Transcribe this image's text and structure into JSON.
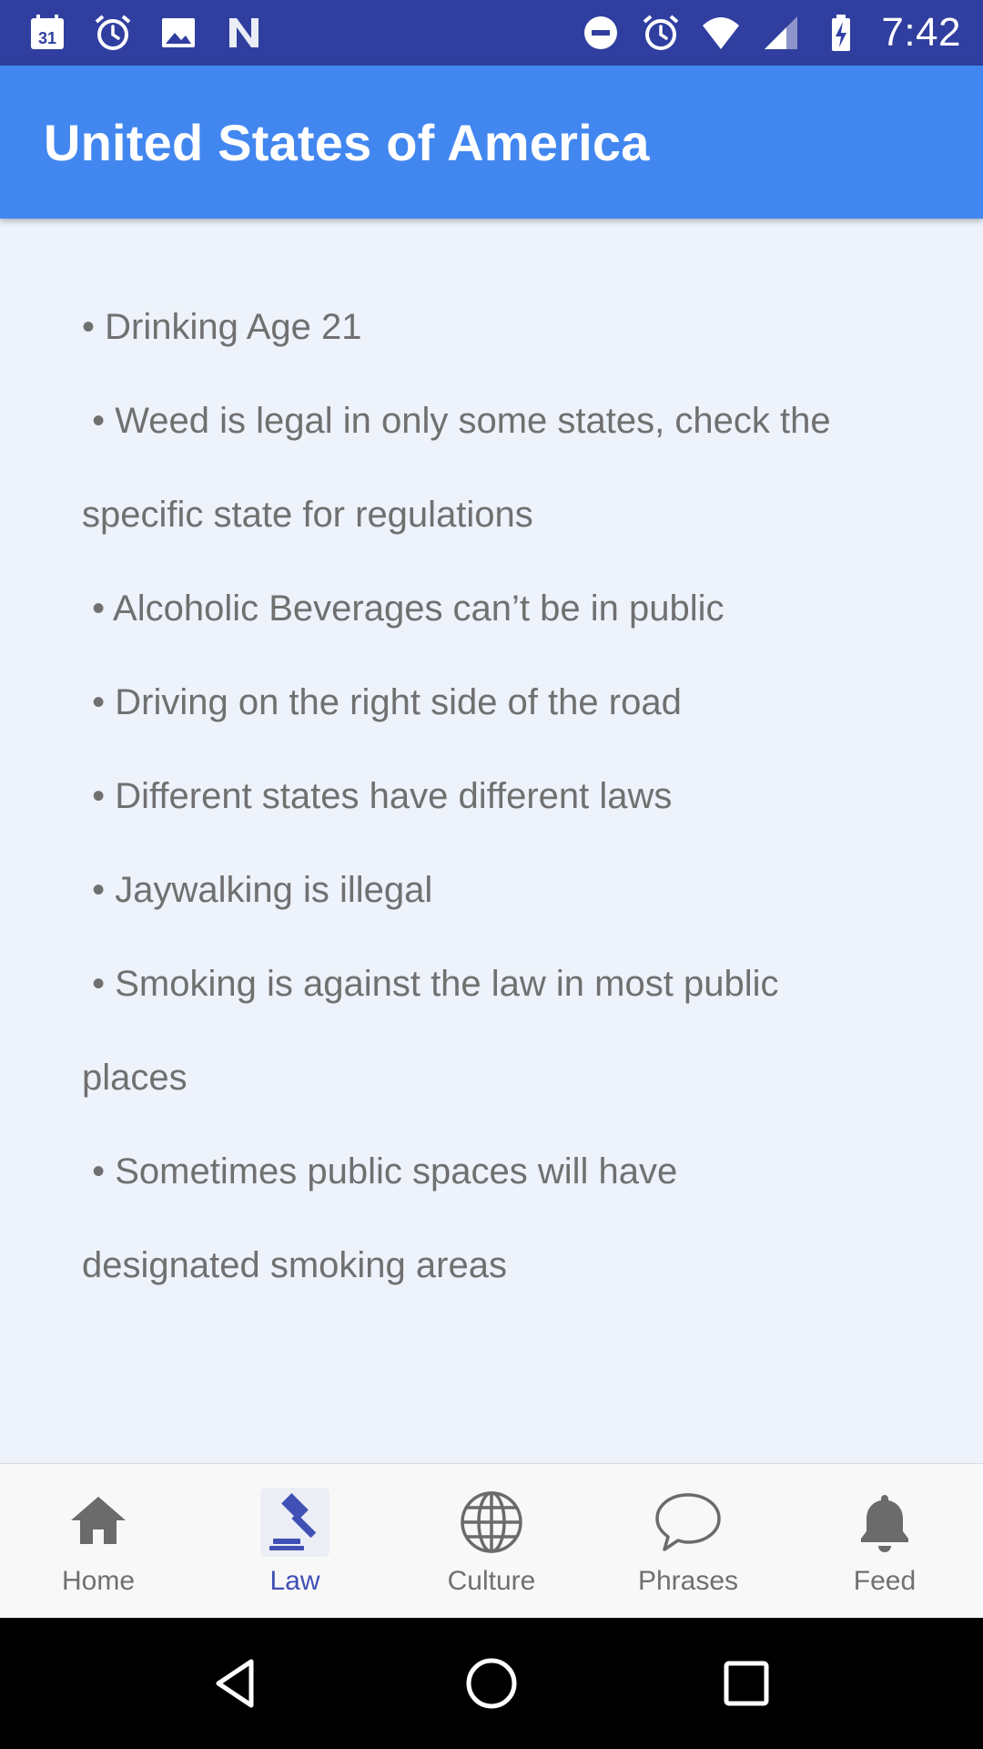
{
  "status_bar": {
    "left_icons": [
      "calendar-icon",
      "alarm-icon",
      "image-icon",
      "n-icon"
    ],
    "calendar_day": "31",
    "right_icons": [
      "dnd-icon",
      "alarm-icon",
      "wifi-icon",
      "signal-icon",
      "battery-charging-icon"
    ],
    "time": "7:42"
  },
  "app_bar": {
    "title": "United States of America"
  },
  "laws": {
    "lines": [
      "• Drinking Age 21",
      " • Weed is legal in only some states, check the",
      "specific state for regulations",
      " • Alcoholic Beverages can’t be in public",
      " • Driving on the right side of the road",
      " • Different states have different laws",
      " • Jaywalking is illegal",
      " • Smoking is against the law in most public",
      "places",
      " • Sometimes public spaces will have",
      "designated smoking areas"
    ]
  },
  "bottom_nav": {
    "items": [
      {
        "label": "Home",
        "icon": "home-icon",
        "active": false
      },
      {
        "label": "Law",
        "icon": "gavel-icon",
        "active": true
      },
      {
        "label": "Culture",
        "icon": "globe-icon",
        "active": false
      },
      {
        "label": "Phrases",
        "icon": "chat-bubble-icon",
        "active": false
      },
      {
        "label": "Feed",
        "icon": "bell-icon",
        "active": false
      }
    ],
    "active_color": "#3f51b5",
    "inactive_color": "#707070"
  },
  "colors": {
    "status_bar": "#303f9f",
    "app_bar": "#4287f0",
    "background": "#edf2fb"
  }
}
